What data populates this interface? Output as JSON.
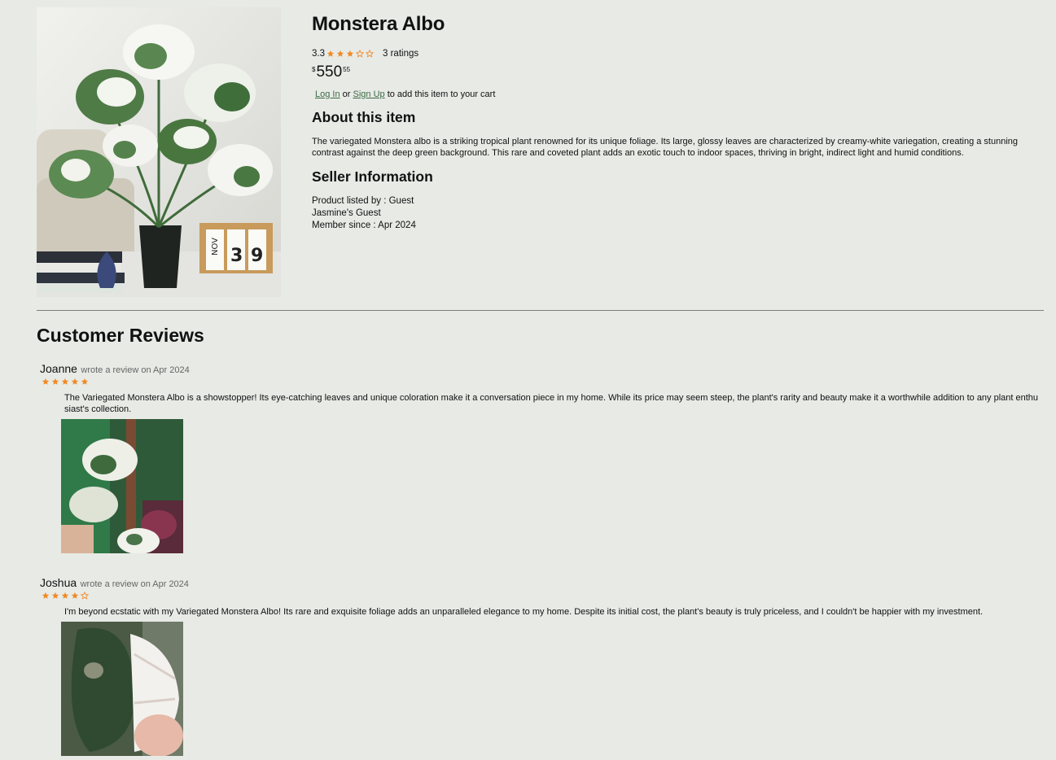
{
  "product": {
    "title": "Monstera Albo",
    "rating_value": "3.3",
    "rating_stars": 3.3,
    "ratings_count": "3 ratings",
    "price_symbol": "$",
    "price_whole": "550",
    "price_fraction": "55",
    "image_alt": "Variegated Monstera Albo plant in a black pot"
  },
  "cart_prompt": {
    "login_label": "Log In",
    "or_text": "or",
    "signup_label": "Sign Up",
    "suffix_text": "to add this item to your cart"
  },
  "about": {
    "heading": "About this item",
    "text": "The variegated Monstera albo is a striking tropical plant renowned for its unique foliage. Its large, glossy leaves are characterized by creamy-white variegation, creating a stunning contrast against the deep green background. This rare and coveted plant adds an exotic touch to indoor spaces, thriving in bright, indirect light and humid conditions."
  },
  "seller": {
    "heading": "Seller Information",
    "listed_by": "Product listed by : Guest",
    "store_name": "Jasmine's Guest",
    "member_since": "Member since : Apr 2024"
  },
  "reviews": {
    "heading": "Customer Reviews",
    "items": [
      {
        "name": "Joanne",
        "meta": "wrote a review on Apr 2024",
        "stars": 5,
        "text": "The Variegated Monstera Albo is a showstopper! Its eye-catching leaves and unique coloration make it a conversation piece in my home. While its price may seem steep, the plant's rarity and beauty make it a worthwhile addition to any plant enthusiast's collection."
      },
      {
        "name": "Joshua",
        "meta": "wrote a review on Apr 2024",
        "stars": 4,
        "text": "I'm beyond ecstatic with my Variegated Monstera Albo! Its rare and exquisite foliage adds an unparalleled elegance to my home. Despite its initial cost, the plant's beauty is truly priceless, and I couldn't be happier with my investment."
      }
    ]
  },
  "colors": {
    "background": "#e8eae6",
    "star": "#f08a24",
    "link": "#3c6b45",
    "divider": "#7d7d7d"
  }
}
